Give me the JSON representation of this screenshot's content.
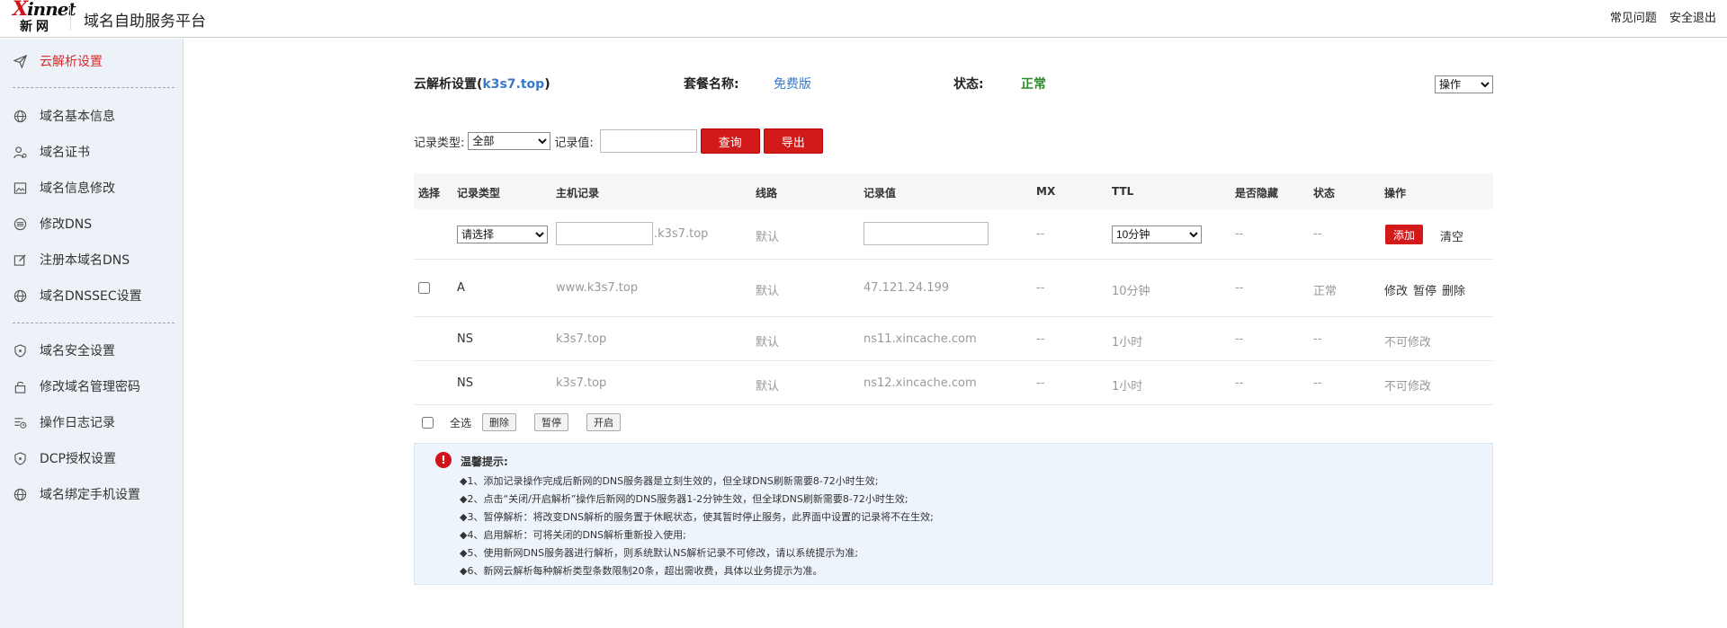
{
  "header": {
    "logo_brand": "innet",
    "logo_x": "X",
    "logo_cn": "新网",
    "title": "域名自助服务平台",
    "links": [
      "常见问题",
      "安全退出"
    ]
  },
  "sidebar": {
    "items": [
      {
        "label": "云解析设置",
        "icon": "paper-plane-icon",
        "active": true
      },
      {
        "label": "域名基本信息",
        "icon": "globe-icon"
      },
      {
        "label": "域名证书",
        "icon": "user-cert-icon"
      },
      {
        "label": "域名信息修改",
        "icon": "image-edit-icon"
      },
      {
        "label": "修改DNS",
        "icon": "dns-icon"
      },
      {
        "label": "注册本域名DNS",
        "icon": "edit-icon"
      },
      {
        "label": "域名DNSSEC设置",
        "icon": "globe-icon"
      },
      {
        "label": "域名安全设置",
        "icon": "shield-icon"
      },
      {
        "label": "修改域名管理密码",
        "icon": "lock-icon"
      },
      {
        "label": "操作日志记录",
        "icon": "log-icon"
      },
      {
        "label": "DCP授权设置",
        "icon": "shield-icon"
      },
      {
        "label": "域名绑定手机设置",
        "icon": "globe-icon"
      }
    ]
  },
  "main": {
    "heading_prefix": "云解析设置(",
    "domain": "k3s7.top",
    "heading_suffix": ")",
    "plan_label": "套餐名称:",
    "plan_value": "免费版",
    "status_label": "状态:",
    "status_value": "正常",
    "op_select": "操作",
    "filter": {
      "type_label": "记录类型:",
      "type_value": "全部",
      "value_label": "记录值:",
      "value_input": "",
      "query_btn": "查询",
      "export_btn": "导出"
    },
    "table": {
      "headers": [
        "选择",
        "记录类型",
        "主机记录",
        "线路",
        "记录值",
        "MX",
        "TTL",
        "是否隐藏",
        "状态",
        "操作"
      ],
      "new_row": {
        "type_select": "请选择",
        "host_input": "",
        "host_suffix": ".k3s7.top",
        "line": "默认",
        "value_input": "",
        "mx": "--",
        "ttl_select": "10分钟",
        "hidden": "--",
        "status": "--",
        "add_btn": "添加",
        "clear_link": "清空"
      },
      "rows": [
        {
          "type": "A",
          "host": "www.k3s7.top",
          "line": "默认",
          "value": "47.121.24.199",
          "mx": "--",
          "ttl": "10分钟",
          "hidden": "--",
          "status": "正常",
          "actions": [
            "修改",
            "暂停",
            "删除"
          ]
        },
        {
          "type": "NS",
          "host": "k3s7.top",
          "line": "默认",
          "value": "ns11.xincache.com",
          "mx": "--",
          "ttl": "1小时",
          "hidden": "--",
          "status": "--",
          "note": "不可修改"
        },
        {
          "type": "NS",
          "host": "k3s7.top",
          "line": "默认",
          "value": "ns12.xincache.com",
          "mx": "--",
          "ttl": "1小时",
          "hidden": "--",
          "status": "--",
          "note": "不可修改"
        }
      ]
    },
    "bulk": {
      "select_all": "全选",
      "buttons": [
        "删除",
        "暂停",
        "开启"
      ]
    },
    "tips": {
      "title": "温馨提示:",
      "lines": [
        "◆1、添加记录操作完成后新网的DNS服务器是立刻生效的，但全球DNS刷新需要8-72小时生效;",
        "◆2、点击“关闭/开启解析”操作后新网的DNS服务器1-2分钟生效，但全球DNS刷新需要8-72小时生效;",
        "◆3、暂停解析：将改变DNS解析的服务置于休眠状态，使其暂时停止服务，此界面中设置的记录将不在生效;",
        "◆4、启用解析：可将关闭的DNS解析重新投入使用;",
        "◆5、使用新网DNS服务器进行解析，则系统默认NS解析记录不可修改，请以系统提示为准;",
        "◆6、新网云解析每种解析类型条数限制20条，超出需收费，具体以业务提示为准。"
      ]
    }
  }
}
